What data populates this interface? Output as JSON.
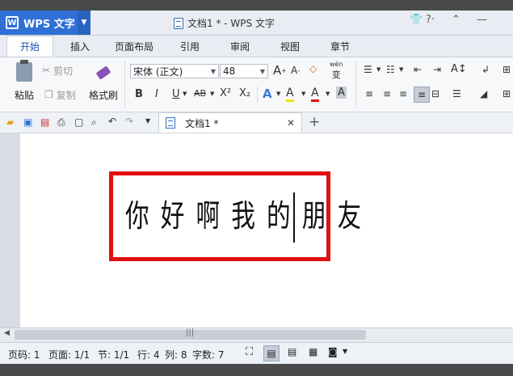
{
  "app": {
    "name": "WPS 文字",
    "logo": "W"
  },
  "window": {
    "title": "文档1 * - WPS 文字"
  },
  "menu_tabs": [
    "开始",
    "插入",
    "页面布局",
    "引用",
    "审阅",
    "视图",
    "章节"
  ],
  "ribbon": {
    "paste": "粘贴",
    "cut": "剪切",
    "copy": "复制",
    "format_painter": "格式刷",
    "font_name": "宋体 (正文)",
    "font_size": "48",
    "grow": "A",
    "shrink": "A",
    "phonetic": "变",
    "bold": "B",
    "italic": "I",
    "underline": "U",
    "strike": "AB",
    "sup": "X²",
    "sub": "X₂",
    "text_effect": "A",
    "highlight": "A",
    "font_color": "A",
    "char_shade": "A"
  },
  "doc_tab": {
    "label": "文档1 *"
  },
  "document": {
    "text": "你 好 啊 我 的 朋 友"
  },
  "status": {
    "page_num": "页码: 1",
    "pages": "页面: 1/1",
    "section": "节: 1/1",
    "row": "行: 4",
    "col": "列: 8",
    "words": "字数: 7"
  },
  "colors": {
    "accent": "#2f6fd6",
    "highlight_box": "#e01010"
  }
}
